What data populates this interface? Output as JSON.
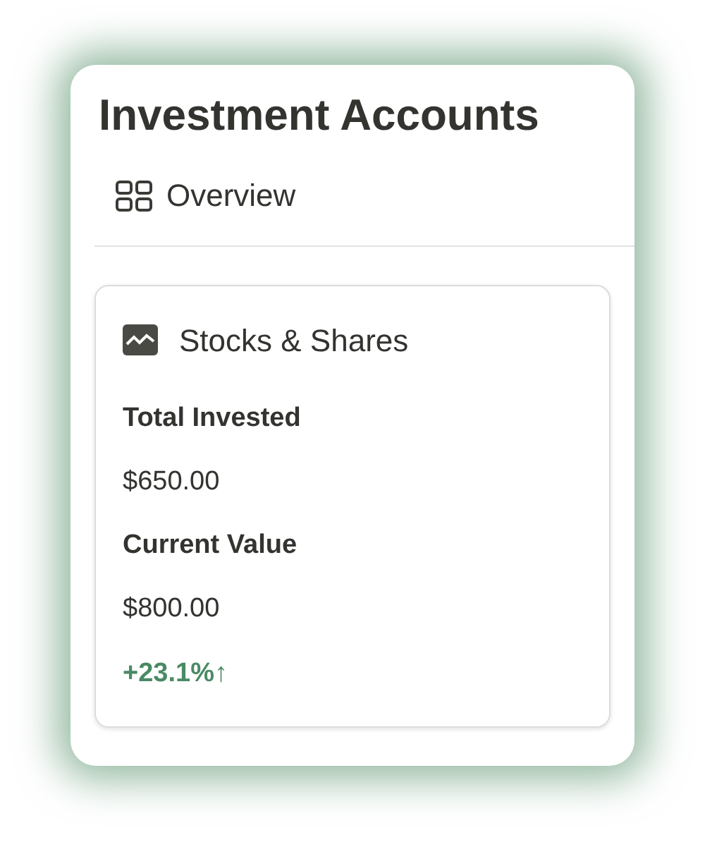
{
  "title": "Investment Accounts",
  "nav": {
    "label": "Overview"
  },
  "account": {
    "name": "Stocks & Shares",
    "fields": [
      {
        "label": "Total Invested",
        "value": "$650.00"
      },
      {
        "label": "Current Value",
        "value": "$800.00"
      }
    ],
    "change": {
      "text": "+23.1%↑",
      "positive": true
    }
  }
}
